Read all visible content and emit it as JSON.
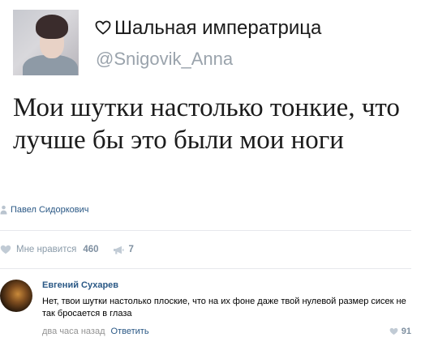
{
  "tweet": {
    "display_name": "Шальная императрица",
    "handle": "@Snigovik_Anna",
    "text": "Мои шутки настолько тонкие, что лучше бы это были мои ноги"
  },
  "post": {
    "author": "Павел Сидоркович",
    "like_label": "Мне нравится",
    "like_count": "460",
    "share_count": "7"
  },
  "comment": {
    "author": "Евгений Сухарев",
    "text": "Нет, твои шутки настолько плоские, что на их фоне даже твой нулевой размер сисек не так бросается в глаза",
    "time": "два часа назад",
    "reply_label": "Ответить",
    "like_count": "91"
  },
  "colors": {
    "link": "#2a5885",
    "muted": "#939393",
    "icon": "#b9c4cf",
    "divider": "#e7e8ec"
  }
}
